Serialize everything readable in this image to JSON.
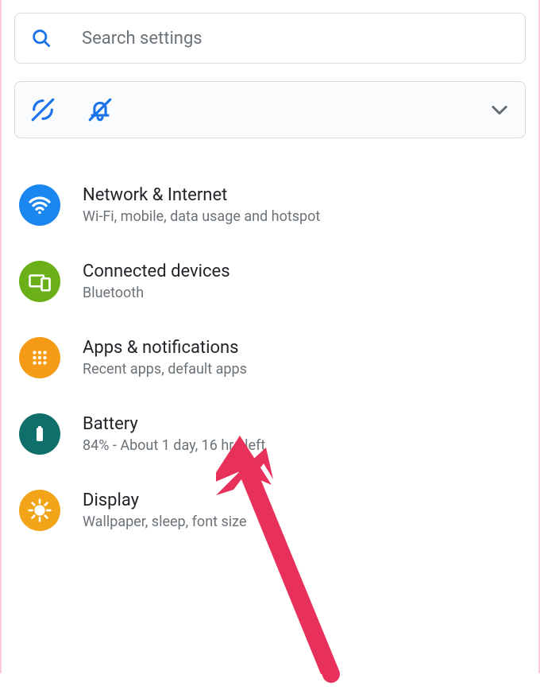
{
  "search": {
    "placeholder": "Search settings"
  },
  "settings": [
    {
      "title": "Network & Internet",
      "subtitle": "Wi-Fi, mobile, data usage and hotspot",
      "icon": "wifi-icon",
      "color": "#1a86f0"
    },
    {
      "title": "Connected devices",
      "subtitle": "Bluetooth",
      "icon": "devices-icon",
      "color": "#6cb019"
    },
    {
      "title": "Apps & notifications",
      "subtitle": "Recent apps, default apps",
      "icon": "apps-icon",
      "color": "#f59b17"
    },
    {
      "title": "Battery",
      "subtitle": "84% - About 1 day, 16 hrs left",
      "icon": "battery-icon",
      "color": "#0e6f6b"
    },
    {
      "title": "Display",
      "subtitle": "Wallpaper, sleep, font size",
      "icon": "display-icon",
      "color": "#f1a417"
    }
  ],
  "annotation": {
    "color": "#e8315a"
  }
}
